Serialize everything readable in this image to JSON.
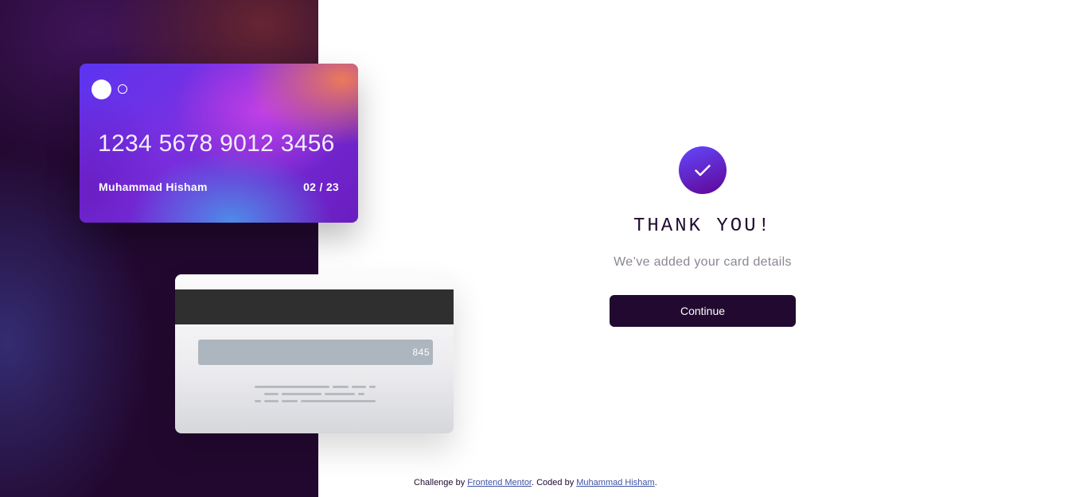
{
  "card_front": {
    "number": "1234 5678 9012 3456",
    "holder_name": "Muhammad Hisham",
    "expiry": "02 / 23"
  },
  "card_back": {
    "cvc": "845"
  },
  "confirmation": {
    "title": "THANK YOU!",
    "subtitle": "We’ve added your card details",
    "continue_label": "Continue"
  },
  "attribution": {
    "prefix": "Challenge by ",
    "challenge_link": "Frontend Mentor",
    "middle": ". Coded by ",
    "author_link": "Muhammad Hisham",
    "suffix": "."
  },
  "colors": {
    "accent_gradient_start": "#6448fe",
    "accent_gradient_end": "#600594",
    "dark_violet": "#21092f",
    "muted_text": "#8e8593",
    "link": "#3e52a3"
  },
  "icons": {
    "success": "checkmark-icon",
    "card_logo": "card-logo-circles"
  }
}
